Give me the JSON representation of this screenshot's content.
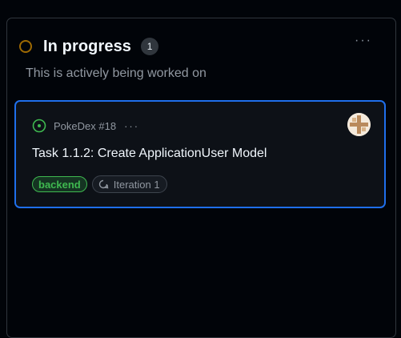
{
  "column": {
    "title": "In progress",
    "count": "1",
    "description": "This is actively being worked on",
    "menu_icon": "kebab-horizontal-icon",
    "status_icon": "status-circle-icon",
    "status_color": "#9e6a03"
  },
  "card": {
    "repo_ref": "PokeDex #18",
    "more_label": "···",
    "title": "Task 1.1.2: Create ApplicationUser Model",
    "issue_icon": "issue-opened-icon",
    "issue_color": "#3fb950",
    "avatar": "avatar-icon",
    "labels": [
      {
        "text": "backend",
        "color": "#3fb950"
      }
    ],
    "iteration": {
      "icon": "iteration-icon",
      "text": "Iteration 1"
    },
    "accent": "#1f6feb"
  }
}
